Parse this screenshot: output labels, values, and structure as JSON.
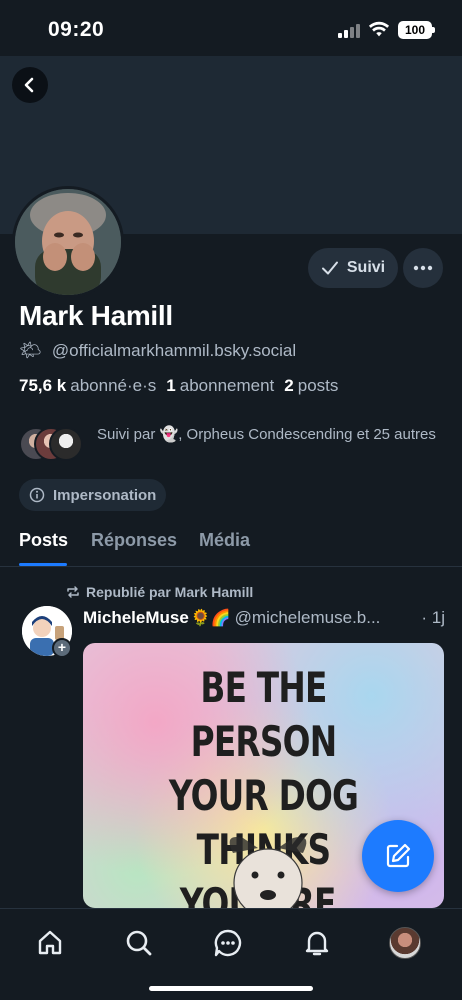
{
  "status_bar": {
    "time": "09:20",
    "battery": "100"
  },
  "profile": {
    "display_name": "Mark Hamill",
    "handle_emoji": "🌤",
    "handle": "@officialmarkhammil.bsky.social",
    "followers_count": "75,6 k",
    "followers_label": "abonné·e·s",
    "following_count": "1",
    "following_label": "abonnement",
    "posts_count": "2",
    "posts_label": "posts",
    "followed_by_text": "Suivi par 👻, Orpheus Condescending et 25 autres",
    "impersonation_label": "Impersonation",
    "follow_button_label": "Suivi"
  },
  "tabs": [
    {
      "label": "Posts",
      "active": true
    },
    {
      "label": "Réponses",
      "active": false
    },
    {
      "label": "Média",
      "active": false
    }
  ],
  "post": {
    "repost_text": "Republié par Mark Hamill",
    "author": "MicheleMuse",
    "author_emojis": "🌻🌈",
    "handle": "@michelemuse.b...",
    "time": "· 1j",
    "image_text_lines": [
      "BE THE PERSON",
      "YOUR DOG THINKS",
      "YOU ARE."
    ]
  },
  "colors": {
    "accent": "#1d7bff",
    "background": "#141b22",
    "banner": "#1e2934"
  },
  "icons": {
    "back": "chevron-left-icon",
    "follow_check": "check-icon",
    "more": "ellipsis-icon",
    "info": "info-icon",
    "repost": "repost-icon",
    "compose": "compose-icon",
    "nav": [
      "home-icon",
      "search-icon",
      "chat-icon",
      "bell-icon",
      "profile-avatar"
    ]
  }
}
